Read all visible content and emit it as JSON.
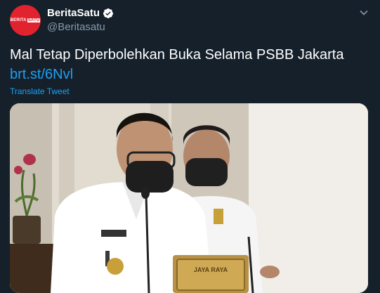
{
  "author": {
    "display_name": "BeritaSatu",
    "handle": "@Beritasatu",
    "avatar_text": "BERITA",
    "avatar_box_text": "SATU",
    "verified": true
  },
  "tweet": {
    "text": "Mal Tetap Diperbolehkan Buka Selama PSBB Jakarta",
    "link": "brt.st/6Nvl",
    "translate_label": "Translate Tweet"
  },
  "media": {
    "podium_text": "JAYA RAYA"
  },
  "colors": {
    "background": "#15202b",
    "link": "#1da1f2",
    "secondary_text": "#8899a6",
    "brand_red": "#e0232e"
  },
  "icons": {
    "verified": "verified-badge-icon",
    "caret": "chevron-down-icon"
  }
}
